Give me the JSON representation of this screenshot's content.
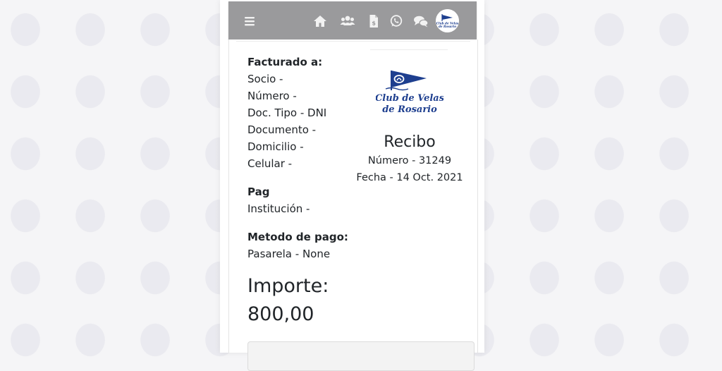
{
  "navbar": {
    "icons": [
      "hamburger-menu-icon",
      "home-icon",
      "users-icon",
      "invoice-icon",
      "whatsapp-icon",
      "chat-icon"
    ],
    "avatar_text": "Club de Velas de Rosario"
  },
  "billing": {
    "heading": "Facturado a:",
    "socio": "Socio -",
    "numero": "Número -",
    "doc_tipo": "Doc. Tipo - DNI",
    "documento": "Documento -",
    "domicilio": "Domicilio -",
    "celular": "Celular -"
  },
  "payment": {
    "heading": "Pag",
    "institucion": "Institución -"
  },
  "method": {
    "heading": "Metodo de pago:",
    "value": "Pasarela - None"
  },
  "amount": {
    "label": "Importe:",
    "value": "800,00"
  },
  "receipt": {
    "logo_line1": "Club de Velas",
    "logo_line2": "de Rosario",
    "title": "Recibo",
    "numero": "Número - 31249",
    "fecha": "Fecha - 14 Oct. 2021"
  },
  "colors": {
    "navbar_bg": "#9a9a9c",
    "logo_blue": "#1e3f8f"
  }
}
